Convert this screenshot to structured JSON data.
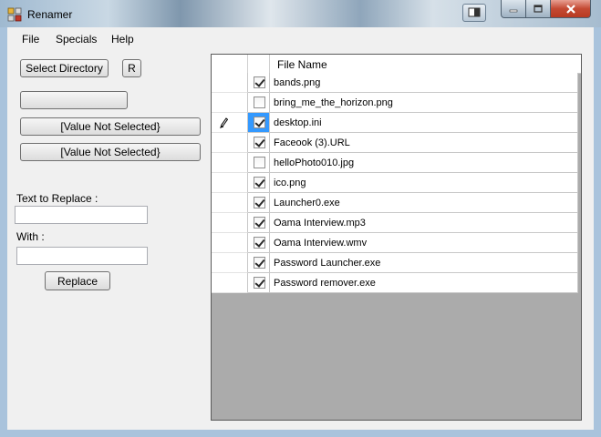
{
  "window": {
    "title": "Renamer"
  },
  "menu": [
    {
      "label": "File"
    },
    {
      "label": "Specials"
    },
    {
      "label": "Help"
    }
  ],
  "controls": {
    "select_directory": "Select Directory",
    "r_button": "R",
    "blank_button": "",
    "value1": "[Value Not Selected}",
    "value2": "[Value Not Selected}",
    "text_to_replace_label": "Text to Replace :",
    "text_to_replace_value": "",
    "with_label": "With :",
    "with_value": "",
    "replace_button": "Replace"
  },
  "grid": {
    "column_header": "File Name",
    "rows": [
      {
        "name": "bands.png",
        "checked": true
      },
      {
        "name": "bring_me_the_horizon.png",
        "checked": false
      },
      {
        "name": "desktop.ini",
        "checked": true,
        "editing": true
      },
      {
        "name": "Faceook (3).URL",
        "checked": true
      },
      {
        "name": "helloPhoto010.jpg",
        "checked": false
      },
      {
        "name": "ico.png",
        "checked": true
      },
      {
        "name": "Launcher0.exe",
        "checked": true
      },
      {
        "name": "Oama Interview.mp3",
        "checked": true
      },
      {
        "name": "Oama Interview.wmv",
        "checked": true
      },
      {
        "name": "Password Launcher.exe",
        "checked": true
      },
      {
        "name": "Password remover.exe",
        "checked": true
      }
    ]
  },
  "colors": {
    "selection": "#3399ff",
    "grid_empty": "#ababab",
    "close_button": "#c44a33"
  }
}
